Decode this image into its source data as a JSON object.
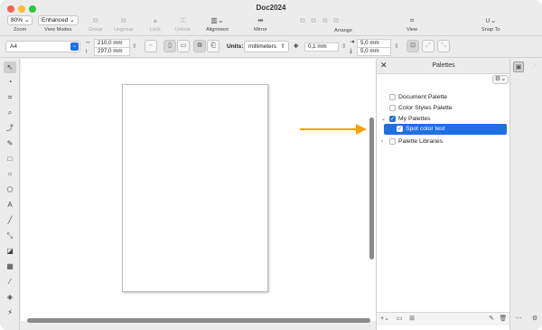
{
  "window": {
    "title": "Doc2024"
  },
  "toolbar": {
    "zoom": {
      "value": "80%",
      "caret": "⌄",
      "label": "Zoom"
    },
    "view_modes": {
      "value": "Enhanced",
      "caret": "⌄",
      "label": "View Modes"
    },
    "group": {
      "icon": "group-icon",
      "label": "Group"
    },
    "ungroup": {
      "icon": "ungroup-icon",
      "label": "Ungroup"
    },
    "lock": {
      "icon": "lock-icon",
      "label": "Lock"
    },
    "unlock": {
      "icon": "unlock-icon",
      "label": "Unlock"
    },
    "alignment": {
      "icon": "alignment-icon",
      "label": "Alignment"
    },
    "mirror": {
      "icon": "mirror-icon",
      "label": "Mirror"
    },
    "arrange": {
      "icon": "arrange-icon",
      "label": "Arrange"
    },
    "view": {
      "icon": "view-icon",
      "label": "View"
    },
    "snap_to": {
      "icon": "magnet-icon",
      "label": "Snap To"
    }
  },
  "property_bar": {
    "page_size": "A4",
    "width": "210,0 mm",
    "height": "297,0 mm",
    "units_label": "Units:",
    "units_value": "millimeters",
    "nudge": "0,1 mm",
    "duplicate_x": "5,0 mm",
    "duplicate_y": "5,0 mm"
  },
  "palettes_panel": {
    "title": "Palettes",
    "items": [
      {
        "label": "Document Palette",
        "checked": false
      },
      {
        "label": "Color Styles Palette",
        "checked": false
      },
      {
        "label": "My Palettes",
        "checked": true,
        "expanded": true
      },
      {
        "label": "Spot color test",
        "checked": true,
        "selected": true
      },
      {
        "label": "Palette Libraries",
        "checked": false
      }
    ]
  },
  "colors": {
    "accent": "#1f6fe5",
    "arrow": "#f5a30a",
    "close": "#fe5f57",
    "minimize": "#febc2e",
    "maximize": "#28c840"
  }
}
